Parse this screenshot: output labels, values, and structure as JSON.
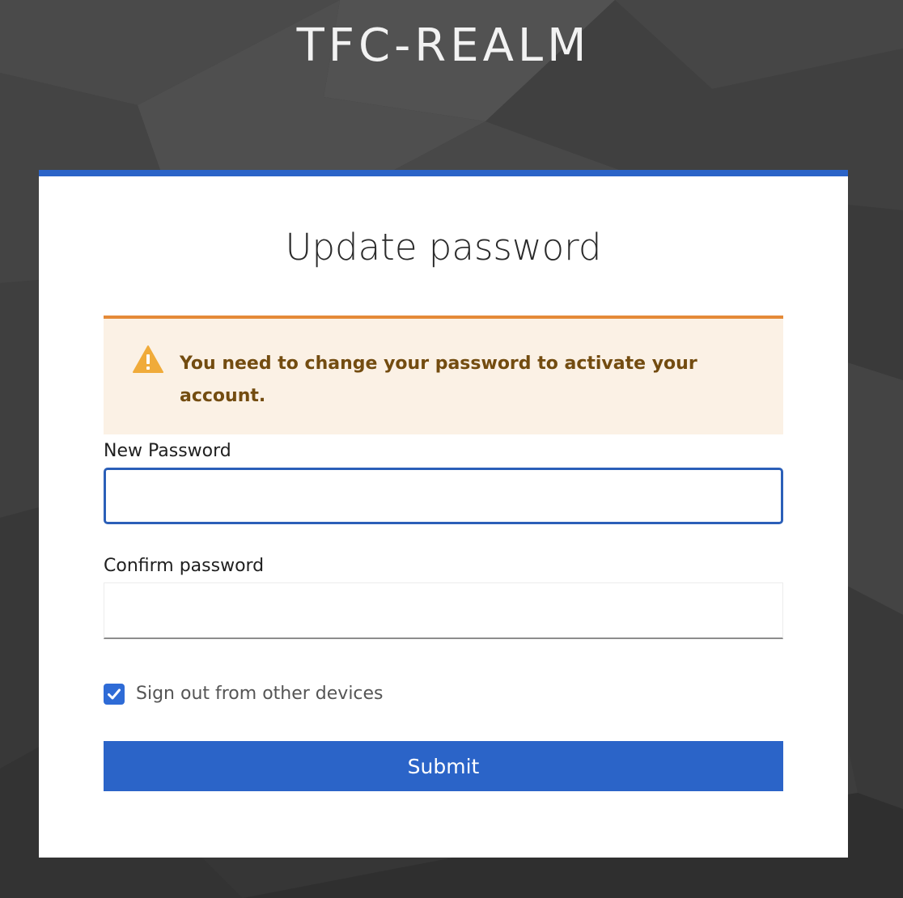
{
  "header": {
    "realm_name": "TFC-REALM"
  },
  "card": {
    "title": "Update password",
    "accent_color": "#2b64c8"
  },
  "alert": {
    "type": "warning",
    "icon": "warning-triangle-icon",
    "message": "You need to change your password to activate your account.",
    "border_color": "#e58a38",
    "background_color": "#fbf1e5",
    "text_color": "#734c10"
  },
  "form": {
    "new_password": {
      "label": "New Password",
      "value": "",
      "focused": true
    },
    "confirm_password": {
      "label": "Confirm password",
      "value": ""
    },
    "logout_sessions": {
      "label": "Sign out from other devices",
      "checked": true
    },
    "submit_label": "Submit"
  }
}
